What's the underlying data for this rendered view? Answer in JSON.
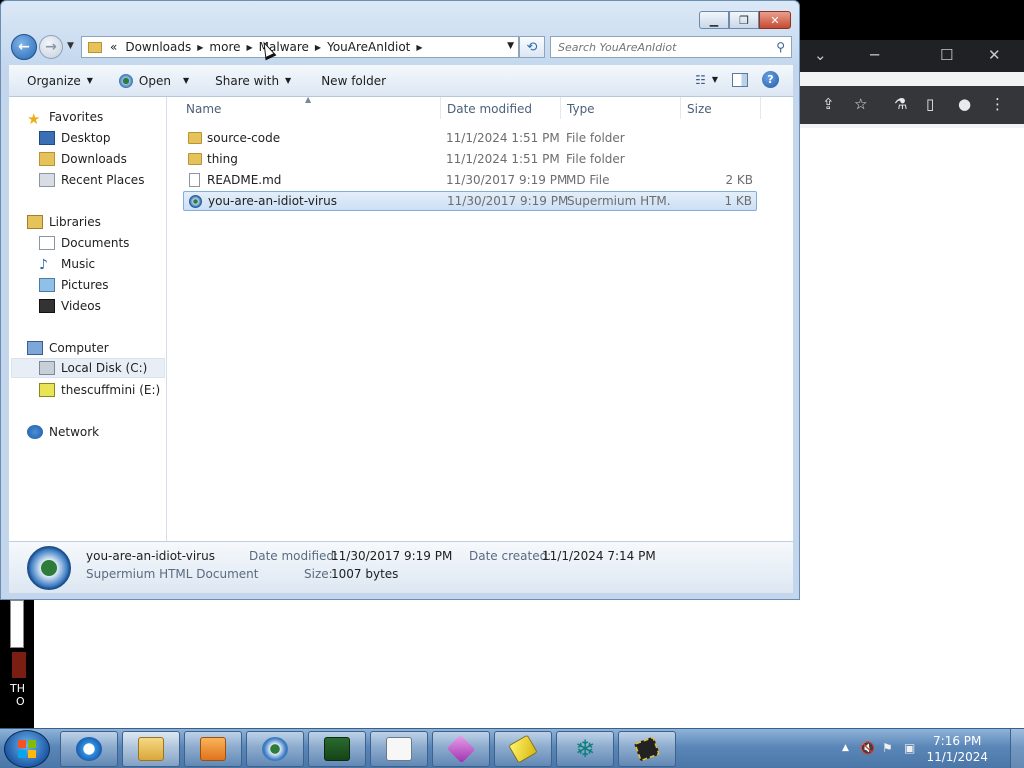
{
  "address": {
    "overflow": "«",
    "crumbs": [
      "Downloads",
      "more",
      "Malware",
      "YouAreAnIdiot"
    ]
  },
  "search": {
    "placeholder": "Search YouAreAnIdiot"
  },
  "cmdbar": {
    "organize": "Organize",
    "open": "Open",
    "share_with": "Share with",
    "new_folder": "New folder"
  },
  "nav": {
    "favorites": "Favorites",
    "desktop": "Desktop",
    "downloads": "Downloads",
    "recent_places": "Recent Places",
    "libraries": "Libraries",
    "documents": "Documents",
    "music": "Music",
    "pictures": "Pictures",
    "videos": "Videos",
    "computer": "Computer",
    "local_disk": "Local Disk (C:)",
    "usb_drive": "thescuffmini (E:)",
    "network": "Network"
  },
  "columns": {
    "name": "Name",
    "date": "Date modified",
    "type": "Type",
    "size": "Size"
  },
  "files": [
    {
      "name": "source-code",
      "date": "11/1/2024 1:51 PM",
      "type": "File folder",
      "size": ""
    },
    {
      "name": "thing",
      "date": "11/1/2024 1:51 PM",
      "type": "File folder",
      "size": ""
    },
    {
      "name": "README.md",
      "date": "11/30/2017 9:19 PM",
      "type": "MD File",
      "size": "2 KB"
    },
    {
      "name": "you-are-an-idiot-virus",
      "date": "11/30/2017 9:19 PM",
      "type": "Supermium HTM...",
      "size": "1 KB"
    }
  ],
  "details": {
    "name": "you-are-an-idiot-virus",
    "type": "Supermium HTML Document",
    "date_modified_label": "Date modified:",
    "date_modified": "11/30/2017 9:19 PM",
    "date_created_label": "Date created:",
    "date_created": "11/1/2024 7:14 PM",
    "size_label": "Size:",
    "size": "1007 bytes"
  },
  "background": {
    "left_text_1": "TH",
    "left_text_2": "O"
  },
  "clock": {
    "time": "7:16 PM",
    "date": "11/1/2024"
  },
  "colors": {
    "selection": "#cde0f5",
    "taskbar": "#5b87b8",
    "window_frame": "#c3d6ec"
  }
}
